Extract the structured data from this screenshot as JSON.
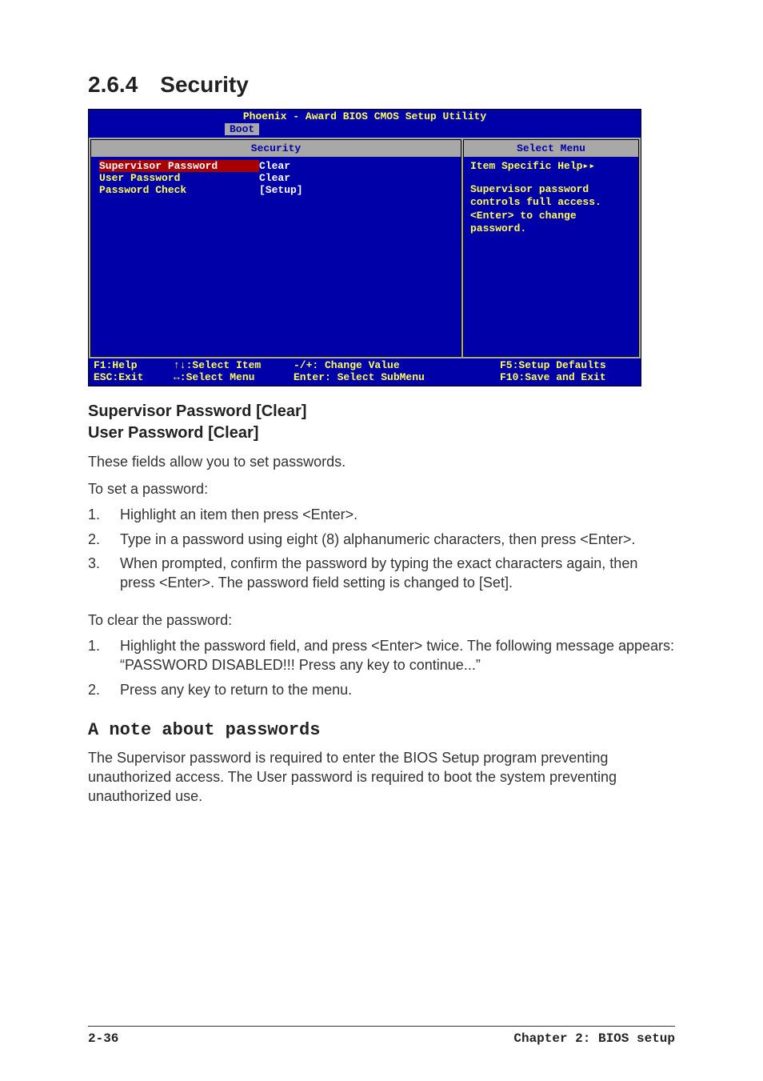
{
  "section": {
    "number": "2.6.4",
    "title": "Security"
  },
  "bios": {
    "title": "Phoenix - Award BIOS CMOS Setup Utility",
    "tab": "Boot",
    "left_header": "Security",
    "right_header": "Select Menu",
    "rows": [
      {
        "label": "Supervisor Password",
        "value": "Clear",
        "selected": true
      },
      {
        "label": "User Password",
        "value": "Clear",
        "selected": false
      },
      {
        "label": "Password Check",
        "value": "[Setup]",
        "selected": false
      }
    ],
    "help_title": "Item Specific Help▸▸",
    "help_body": "Supervisor password controls full access. <Enter> to change password.",
    "footer": {
      "c1a": "F1:Help",
      "c1b": "ESC:Exit",
      "c2a": "↑↓:Select Item",
      "c2b": "↔:Select Menu",
      "c3a": "-/+: Change Value",
      "c3b": "Enter: Select SubMenu",
      "c4a": "F5:Setup Defaults",
      "c4b": "F10:Save and Exit"
    }
  },
  "sub1_line1": "Supervisor Password [Clear]",
  "sub1_line2": "User Password [Clear]",
  "para1": "These fields allow you to set passwords.",
  "para2": "To set a password:",
  "set_steps": [
    "Highlight an item then press <Enter>.",
    "Type in a password using eight (8) alphanumeric characters, then press <Enter>.",
    "When prompted, confirm the password by typing the exact characters again, then press <Enter>.  The password field setting is changed to [Set]."
  ],
  "para3": "To clear the password:",
  "clear_steps": [
    "Highlight the password field, and press <Enter> twice. The following message appears:\n“PASSWORD DISABLED!!! Press any key to continue...”",
    "Press any key to return to the menu."
  ],
  "note_heading": "A note about passwords",
  "note_body": "The Supervisor password is required to enter the BIOS Setup program preventing unauthorized access. The User password is required to boot the system preventing unauthorized use.",
  "footer": {
    "page": "2-36",
    "chapter": "Chapter 2: BIOS setup"
  }
}
